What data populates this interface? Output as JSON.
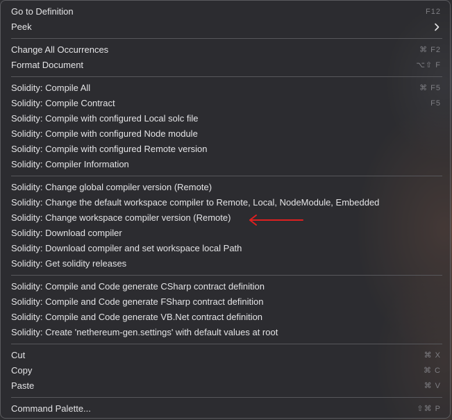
{
  "menu": {
    "items": [
      {
        "label": "Go to Definition",
        "shortcut": "F12"
      },
      {
        "label": "Peek",
        "submenu_icon": "chevron-right-icon"
      },
      {
        "label": "Change All Occurrences",
        "shortcut": "⌘ F2"
      },
      {
        "label": "Format Document",
        "shortcut": "⌥⇧ F"
      },
      {
        "label": "Solidity: Compile All",
        "shortcut": "⌘ F5"
      },
      {
        "label": "Solidity: Compile Contract",
        "shortcut": "F5"
      },
      {
        "label": "Solidity: Compile with configured Local solc file",
        "shortcut": ""
      },
      {
        "label": "Solidity: Compile with configured Node module",
        "shortcut": ""
      },
      {
        "label": "Solidity: Compile with configured Remote version",
        "shortcut": ""
      },
      {
        "label": "Solidity: Compiler Information",
        "shortcut": ""
      },
      {
        "label": "Solidity: Change global compiler version (Remote)",
        "shortcut": ""
      },
      {
        "label": "Solidity: Change the default workspace compiler to Remote, Local, NodeModule, Embedded",
        "shortcut": ""
      },
      {
        "label": "Solidity: Change workspace compiler version (Remote)",
        "shortcut": ""
      },
      {
        "label": "Solidity: Download compiler",
        "shortcut": ""
      },
      {
        "label": "Solidity: Download compiler and set workspace local Path",
        "shortcut": ""
      },
      {
        "label": "Solidity: Get solidity releases",
        "shortcut": ""
      },
      {
        "label": "Solidity: Compile and Code generate CSharp contract definition",
        "shortcut": ""
      },
      {
        "label": "Solidity: Compile and Code generate FSharp contract definition",
        "shortcut": ""
      },
      {
        "label": "Solidity: Compile and Code generate VB.Net contract definition",
        "shortcut": ""
      },
      {
        "label": "Solidity: Create 'nethereum-gen.settings' with default values at root",
        "shortcut": ""
      },
      {
        "label": "Cut",
        "shortcut": "⌘ X"
      },
      {
        "label": "Copy",
        "shortcut": "⌘ C"
      },
      {
        "label": "Paste",
        "shortcut": "⌘ V"
      },
      {
        "label": "Command Palette...",
        "shortcut": "⇧⌘ P"
      }
    ]
  },
  "annotation": {
    "icon": "left-arrow-icon",
    "color": "#e02020"
  }
}
